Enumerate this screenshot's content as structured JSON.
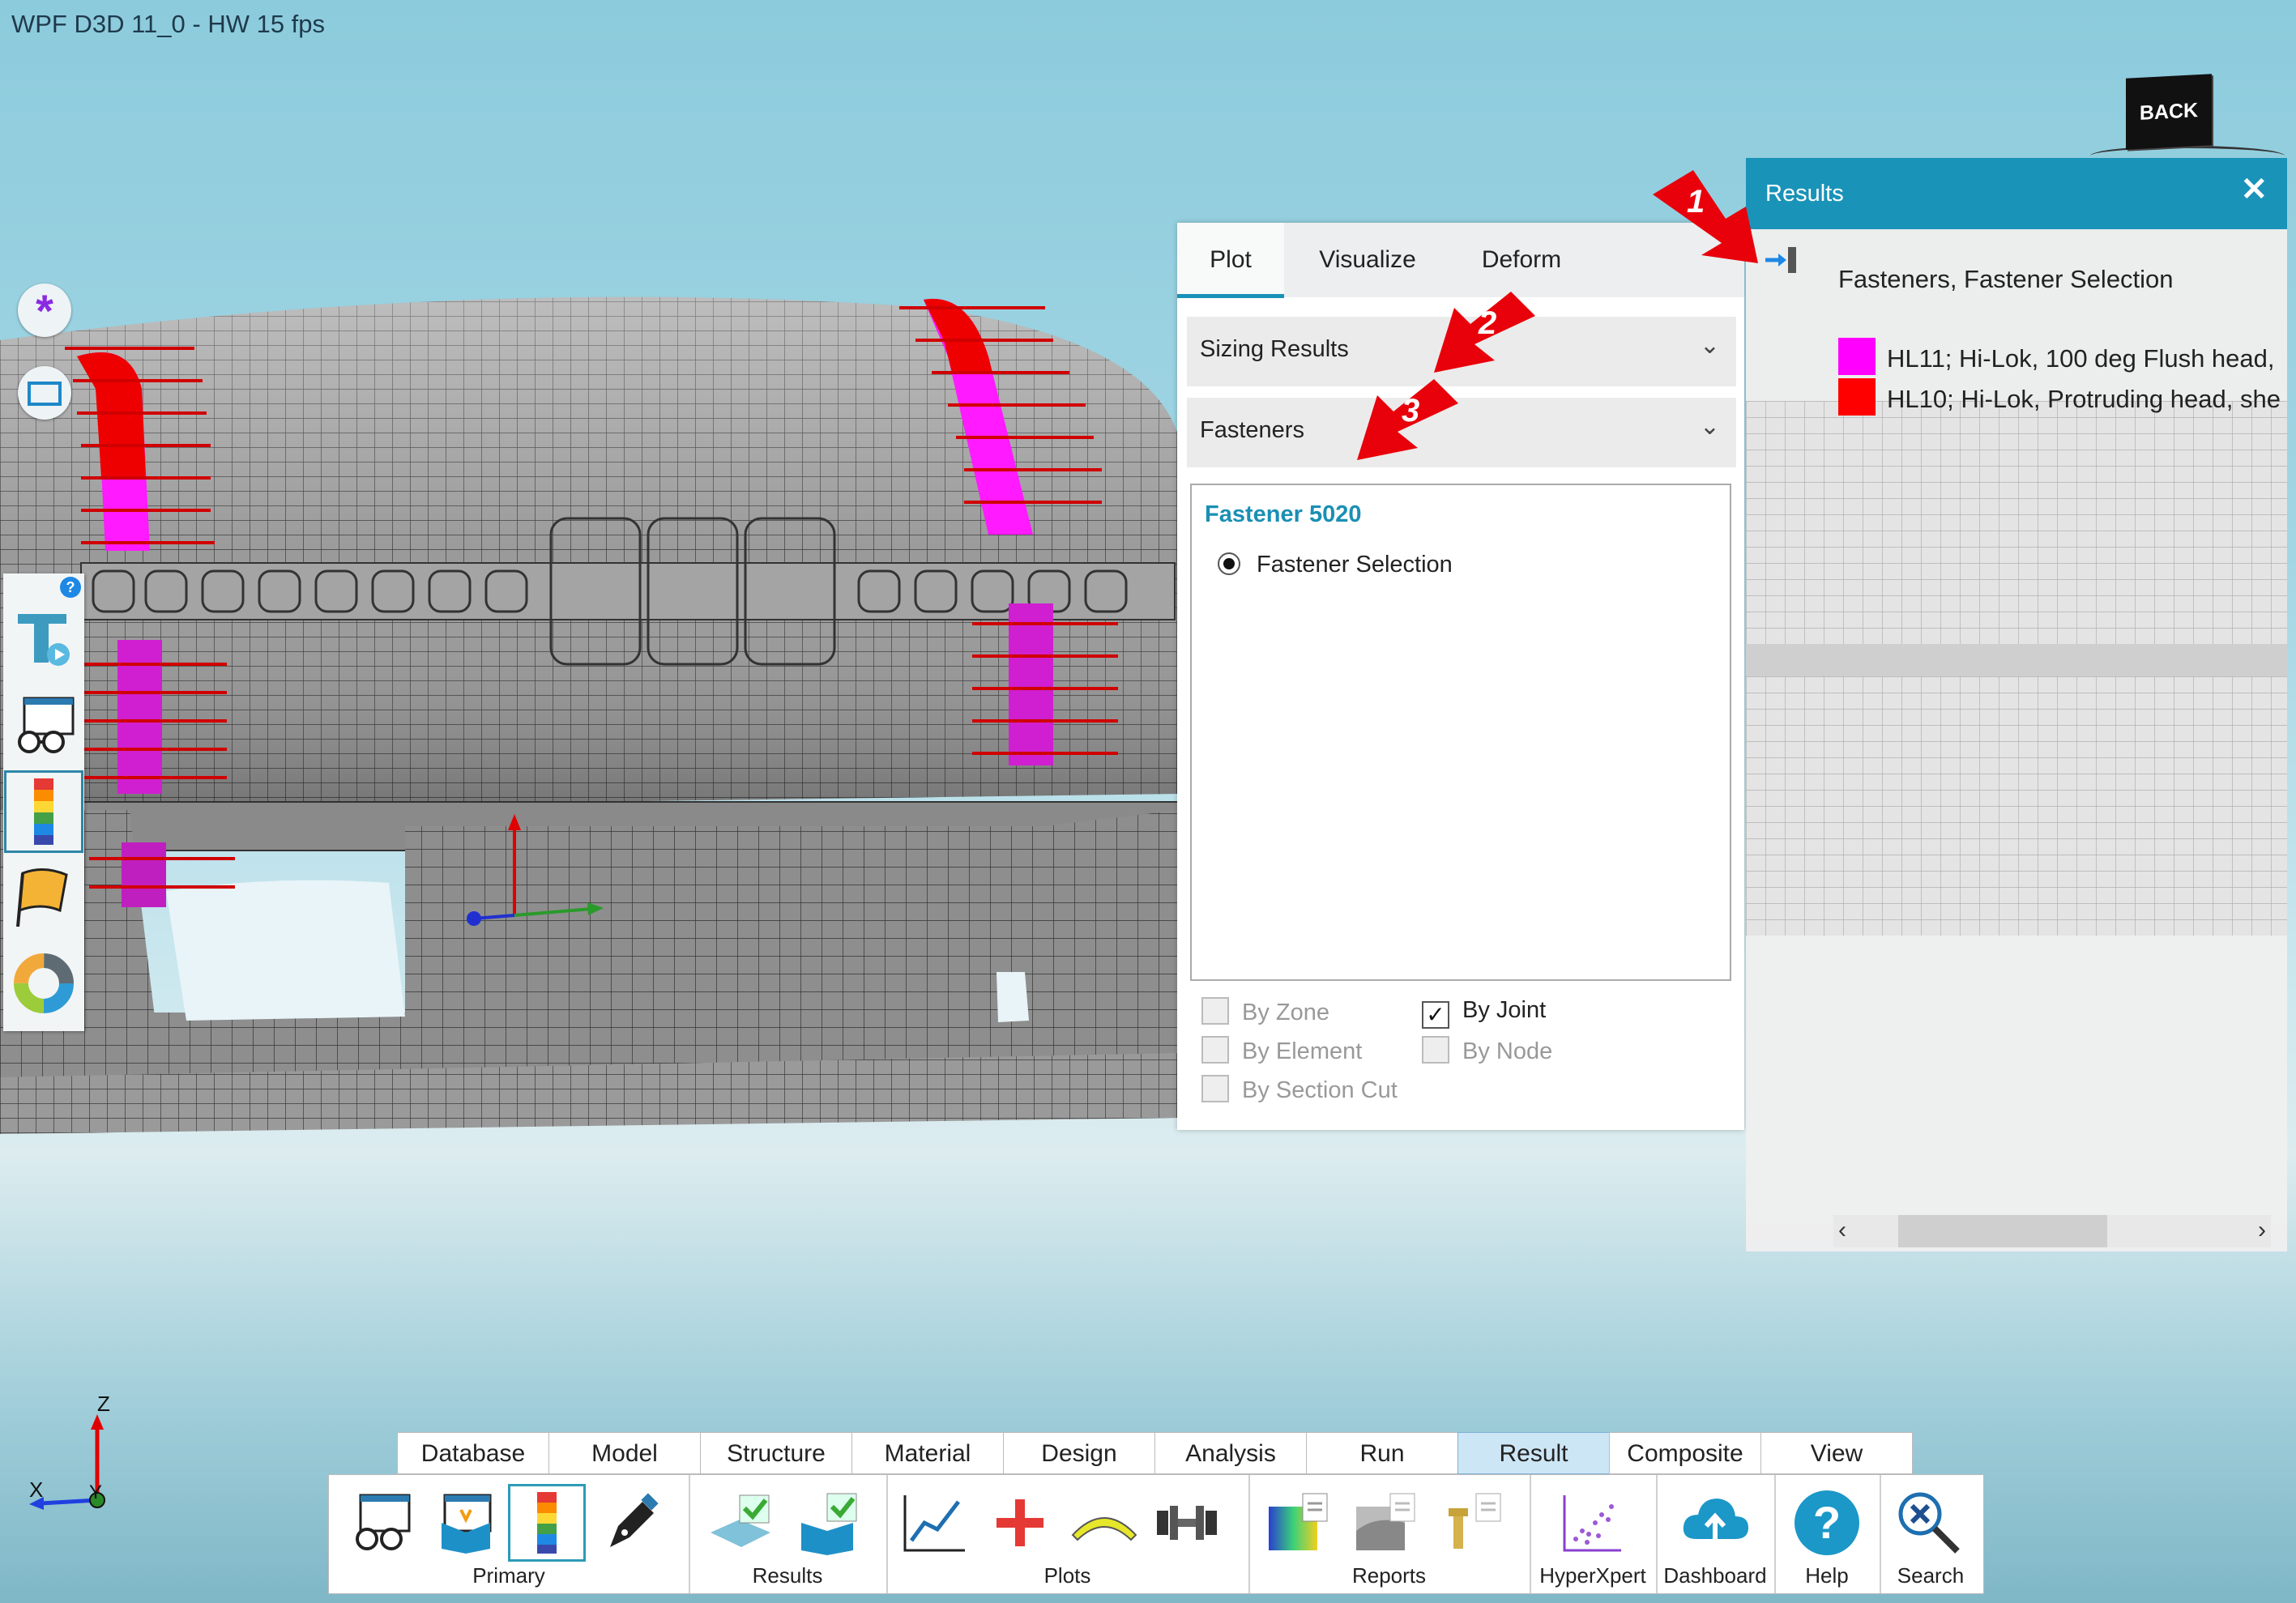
{
  "window": {
    "title": "WPF D3D 11_0 - HW  15  fps"
  },
  "view_cube": {
    "back_label": "BACK"
  },
  "plot_panel": {
    "tabs": [
      {
        "label": "Plot",
        "active": true
      },
      {
        "label": "Visualize",
        "active": false
      },
      {
        "label": "Deform",
        "active": false
      }
    ],
    "sections": [
      {
        "label": "Sizing Results"
      },
      {
        "label": "Fasteners"
      }
    ],
    "list": {
      "title": "Fastener 5020",
      "items": [
        {
          "label": "Fastener Selection",
          "selected": true
        }
      ]
    },
    "checkboxes": [
      {
        "label": "By Zone",
        "checked": false,
        "enabled": false
      },
      {
        "label": "By Joint",
        "checked": true,
        "enabled": true
      },
      {
        "label": "By Element",
        "checked": false,
        "enabled": false
      },
      {
        "label": "By Node",
        "checked": false,
        "enabled": false
      },
      {
        "label": "By Section Cut",
        "checked": false,
        "enabled": false
      }
    ]
  },
  "results_panel": {
    "title": "Results",
    "subtitle": "Fasteners, Fastener Selection",
    "legend": [
      {
        "color": "#ff00ff",
        "label": "HL11; Hi-Lok, 100 deg Flush head, "
      },
      {
        "color": "#ff0000",
        "label": "HL10; Hi-Lok, Protruding head, she"
      }
    ]
  },
  "callouts": [
    "1",
    "2",
    "3"
  ],
  "axis_triad": {
    "z": "Z",
    "x": "X",
    "y": "Y"
  },
  "ribbon": {
    "tabs": [
      "Database",
      "Model",
      "Structure",
      "Material",
      "Design",
      "Analysis",
      "Run",
      "Result",
      "Composite",
      "View"
    ],
    "active_tab": "Result",
    "groups": [
      {
        "label": "Primary",
        "icons": [
          "glasses-icon",
          "palette-icon",
          "contour-legend-icon",
          "pen-icon"
        ]
      },
      {
        "label": "Results",
        "icons": [
          "results-check-icon",
          "results-book-icon"
        ]
      },
      {
        "label": "Plots",
        "icons": [
          "line-plot-icon",
          "cross-plot-icon",
          "arc-plot-icon",
          "dumbbell-plot-icon"
        ]
      },
      {
        "label": "Reports",
        "icons": [
          "report-contour-icon",
          "report-gray-icon",
          "report-fastener-icon"
        ]
      },
      {
        "label": "HyperXpert",
        "icons": [
          "scatter-icon"
        ]
      },
      {
        "label": "Dashboard",
        "icons": [
          "cloud-upload-icon"
        ]
      },
      {
        "label": "Help",
        "icons": [
          "help-icon"
        ]
      },
      {
        "label": "Search",
        "icons": [
          "search-icon"
        ]
      }
    ]
  },
  "colors": {
    "accent": "#1a93b9",
    "fastener_hl11": "#ff00ff",
    "fastener_hl10": "#ff0000",
    "callout": "#e8000a"
  }
}
